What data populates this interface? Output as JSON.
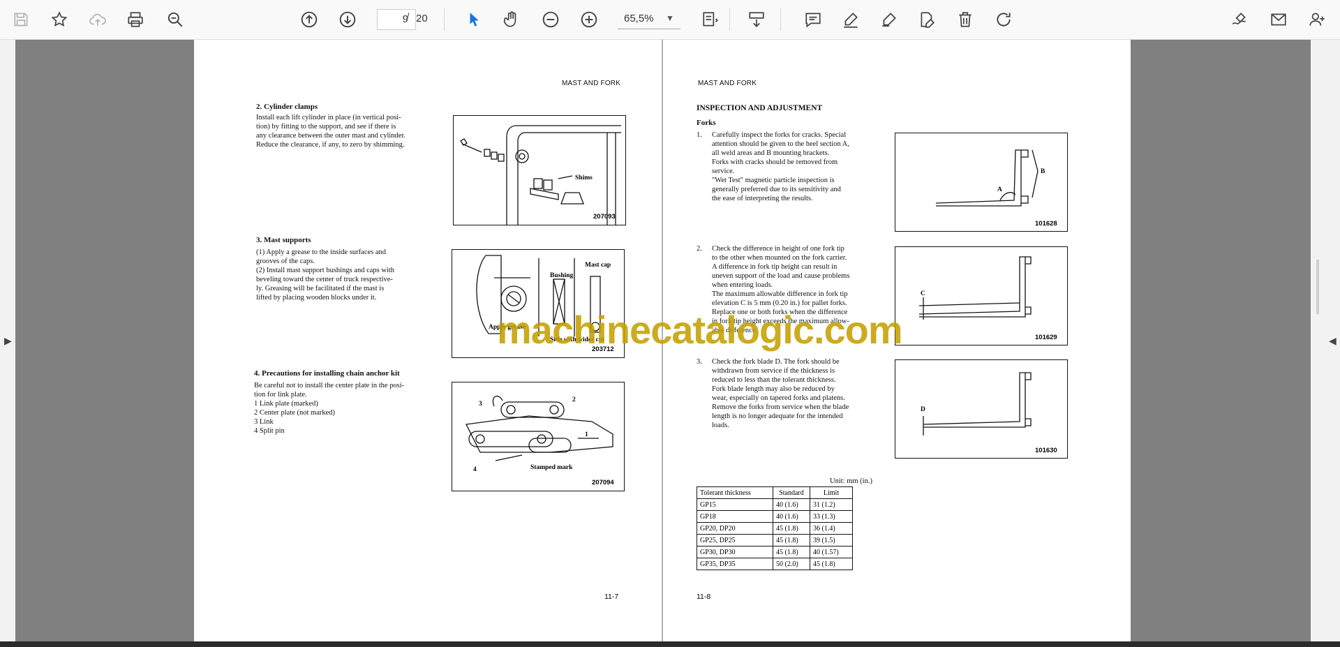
{
  "toolbar": {
    "current_page": "9",
    "page_separator": "/",
    "total_pages": "20",
    "zoom": "65,5%"
  },
  "left_page": {
    "header": "MAST AND FORK",
    "sections": [
      {
        "title": "2.   Cylinder clamps",
        "lines": [
          "Install each lift cylinder in place (in vertical posi-",
          "tion) by fitting to the support, and see if there is",
          "any clearance between the outer mast and cylinder.",
          "Reduce the clearance, if any, to zero by shimming."
        ]
      },
      {
        "title": "3.   Mast supports",
        "lines": [
          "(1)  Apply a grease to the inside surfaces and",
          "       grooves of the caps.",
          "(2)  Install mast support bushings and caps with",
          "       beveling toward the center of truck respective-",
          "       ly. Greasing will be facilitated if the mast is",
          "       lifted by placing wooden blocks under it."
        ]
      },
      {
        "title": "4.   Precautions for installing chain anchor kit",
        "lines": [
          "Be careful not to install the center plate in the posi-",
          "tion for link plate.",
          "  1  Link plate (marked)",
          "  2  Center plate (not marked)",
          "  3  Link",
          "  4  Split pin"
        ]
      }
    ],
    "fig1": {
      "number": "207093",
      "label_shims": "Shims"
    },
    "fig2": {
      "number": "203712",
      "label_bushing": "Bushing",
      "label_mastcap": "Mast cap",
      "label_apply": "Apply grease",
      "label_side": "Side with wider cut"
    },
    "fig3": {
      "number": "207094",
      "label_stamped": "Stamped mark",
      "n1": "1",
      "n2": "2",
      "n3": "3",
      "n4": "4"
    },
    "footer": "11-7"
  },
  "right_page": {
    "header": "MAST AND FORK",
    "title": "INSPECTION AND ADJUSTMENT",
    "subtitle": "Forks",
    "items": [
      {
        "num": "1.",
        "lines": [
          "Carefully inspect the forks for cracks. Special",
          "attention should be given to the heel section A,",
          "all weld areas and B mounting brackets.",
          "Forks with cracks should be removed from",
          "service.",
          "\"Wet Test\" magnetic particle inspection is",
          "generally preferred due to its sensitivity and",
          "the ease of interpreting the results."
        ]
      },
      {
        "num": "2.",
        "lines": [
          "Check the difference in height of one fork tip",
          "to the other when mounted on the fork carrier.",
          "A difference in fork tip height can result in",
          "uneven support of the load and cause problems",
          "when entering loads.",
          "The maximum allowable difference in fork tip",
          "elevation C is 5 mm (0.20 in.) for pallet forks.",
          "Replace one or both forks when the difference",
          "in fork tip height exceeds the maximum allow-",
          "able difference."
        ]
      },
      {
        "num": "3.",
        "lines": [
          "Check the fork blade D. The fork should be",
          "withdrawn from service if the thickness is",
          "reduced to less than the tolerant thickness.",
          "Fork blade length may also be reduced by",
          "wear, especially on tapered forks and platens.",
          "Remove the forks from service when the blade",
          "length is no longer adequate for the intended",
          "loads."
        ]
      }
    ],
    "fig1": {
      "number": "101628",
      "label_a": "A",
      "label_b": "B"
    },
    "fig2": {
      "number": "101629",
      "label_c": "C"
    },
    "fig3": {
      "number": "101630",
      "label_d": "D"
    },
    "unit": "Unit: mm (in.)",
    "table": {
      "headers": [
        "Tolerant thickness",
        "Standard",
        "Limit"
      ],
      "rows": [
        [
          "GP15",
          "40 (1.6)",
          "31 (1.2)"
        ],
        [
          "GP18",
          "40 (1.6)",
          "33 (1.3)"
        ],
        [
          "GP20, DP20",
          "45 (1.8)",
          "36 (1.4)"
        ],
        [
          "GP25, DP25",
          "45 (1.8)",
          "39 (1.5)"
        ],
        [
          "GP30, DP30",
          "45 (1.8)",
          "40 (1.57)"
        ],
        [
          "GP35, DP35",
          "50 (2.0)",
          "45 (1.8)"
        ]
      ]
    },
    "footer": "11-8"
  },
  "watermark": "machinecatalogic.com"
}
